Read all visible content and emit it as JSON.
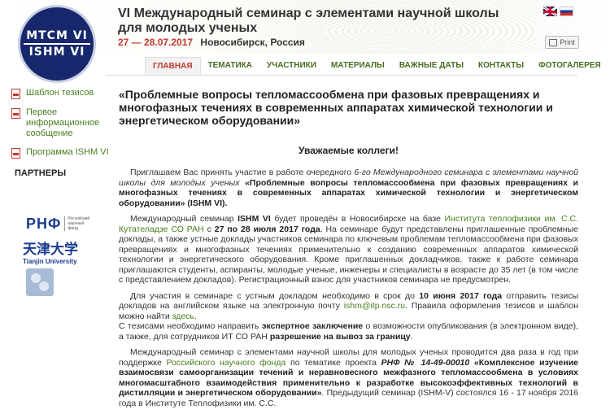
{
  "logo": {
    "line1": "МТСМ VI",
    "line2": "ISHM VI"
  },
  "header": {
    "title": "VI Международный семинар с элементами научной школы для молодых ученых",
    "dates": "27 — 28.07.2017",
    "city": "Новосибирск, Россия",
    "print_label": "Print"
  },
  "nav": [
    "ГЛАВНАЯ",
    "ТЕМАТИКА",
    "УЧАСТНИКИ",
    "МАТЕРИАЛЫ",
    "ВАЖНЫЕ ДАТЫ",
    "КОНТАКТЫ",
    "ФОТОГАЛЕРЕЯ"
  ],
  "sidebar": {
    "links": [
      "Шаблон тезисов",
      "Первое информационное сообщение",
      "Программа ISHM VI"
    ],
    "partners_title": "ПАРТНЕРЫ",
    "rnf": {
      "mark": "РНФ",
      "small": "Российский научный фонд"
    },
    "tianjin": {
      "cn": "天津大学",
      "en": "Tianjin University"
    }
  },
  "main": {
    "headline": "«Проблемные вопросы тепломассообмена при фазовых превращениях и многофазных течениях в современных аппаратах химической технологии и энергетическом оборудовании»",
    "greeting": "Уважаемые коллеги!",
    "p1": {
      "a": "Приглашаем Вас принять участие в работе очередного ",
      "b": "6-го Международного семинара с элементами научной школы для молодых ученых",
      "c": " «Проблемные вопросы тепломассообмена при фазовых превращениях и многофазных течениях в современных аппаратах химической технологии и энергетическом оборудовании» (ISHM VI)."
    },
    "p2": {
      "a": "Международный семинар ",
      "b": "ISHM VI",
      "c": " будет проведён в Новосибирске на базе ",
      "d": "Института теплофизики им. С.С. Кутателадзе СО РАН",
      "e": " с ",
      "f": "27 по 28 июля 2017 года",
      "g": ". На семинаре будут представлены приглашенные проблемные доклады, а также устные доклады участников семинара по ключевым проблемам тепломассообмена при фазовых превращениях и многофазных течениях применительно к созданию современных аппаратов химической технологии и энергетического оборудования. Кроме приглашенных докладчиков, также к работе семинара приглашаются студенты, аспиранты, молодые ученые, инженеры и специалисты в возрасте до 35 лет (в том числе с представлением докладов). Регистрационный взнос для участников семинара не предусмотрен."
    },
    "p3": {
      "a": "Для участия в семинаре с устным докладом необходимо в срок до ",
      "b": "10 июня 2017 года",
      "c": " отправить тезисы докладов на английском языке на электронную почту ",
      "d": "ishm@itp.nsc.ru",
      "e": ". Правила оформления тезисов и шаблон можно найти ",
      "f": "здесь",
      "g": ".",
      "h": "С тезисами необходимо направить ",
      "i": "экспертное заключение",
      "j": " о возможности опубликования (в электронном виде), а также, для сотрудников ИТ СО РАН ",
      "k": "разрешение на вывоз за границу",
      "l": "."
    },
    "p4": {
      "a": "Международный семинар с элементами научной школы для молодых ученых проводится два раза в год при поддержке ",
      "b": "Российского научного фонда",
      "c": " по тематике проекта ",
      "d": "РНФ № 14-49-00010",
      "e": " «Комплексное изучение взаимосвязи самоорганизации течений и неравновесного межфазного тепломассообмена в условиях многомасштабного взаимодействия применительно к разработке высокоэффективных технологий в дистилляции и энергетическом оборудовании»",
      "f": ". Предыдущий семинар (ISHM-V) состоялся 16 - 17 ноября 2016 года в Институте Теплофизики им. С.С."
    }
  },
  "colors": {
    "accent_green": "#4a7d1e",
    "accent_red": "#c0392b",
    "logo_blue": "#16286b"
  }
}
